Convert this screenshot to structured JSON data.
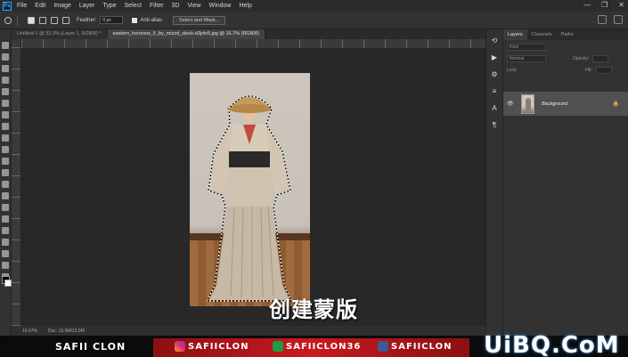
{
  "menubar": {
    "logo": "Ps",
    "items": [
      "File",
      "Edit",
      "Image",
      "Layer",
      "Type",
      "Select",
      "Filter",
      "3D",
      "View",
      "Window",
      "Help"
    ],
    "window_controls": [
      "—",
      "❐",
      "✕"
    ]
  },
  "options": {
    "feather_label": "Feather:",
    "feather_value": "0 px",
    "antialias_label": "Anti-alias",
    "select_mask_label": "Select and Mask..."
  },
  "tabs": [
    {
      "label": "Untitled-1 @ 33.3% (Layer 1, RGB/8) *"
    },
    {
      "label": "eastern_horizons_5_by_mizzd_stock-d3jxlv5.jpg @ 16.7% (RGB/8)"
    }
  ],
  "canvas": {
    "overlay_text": "创建蒙版"
  },
  "status": {
    "zoom": "16.67%",
    "doc": "Doc: 13.9M/13.9M"
  },
  "layers_panel": {
    "tabs": [
      "Layers",
      "Channels",
      "Paths"
    ],
    "kind_label": "Kind",
    "blend_mode": "Normal",
    "opacity_label": "Opacity:",
    "lock_label": "Lock:",
    "fill_label": "Fill:",
    "layer_name": "Background"
  },
  "banner": {
    "left_text": "SAFII CLON",
    "instagram": "SAFIICLON",
    "second": "SAFIICLON36",
    "facebook": "SAFIICLON",
    "brand": "UiBQ.CoM"
  },
  "colors": {
    "accent": "#31a8ff",
    "banner_red": "#c81a1f"
  }
}
